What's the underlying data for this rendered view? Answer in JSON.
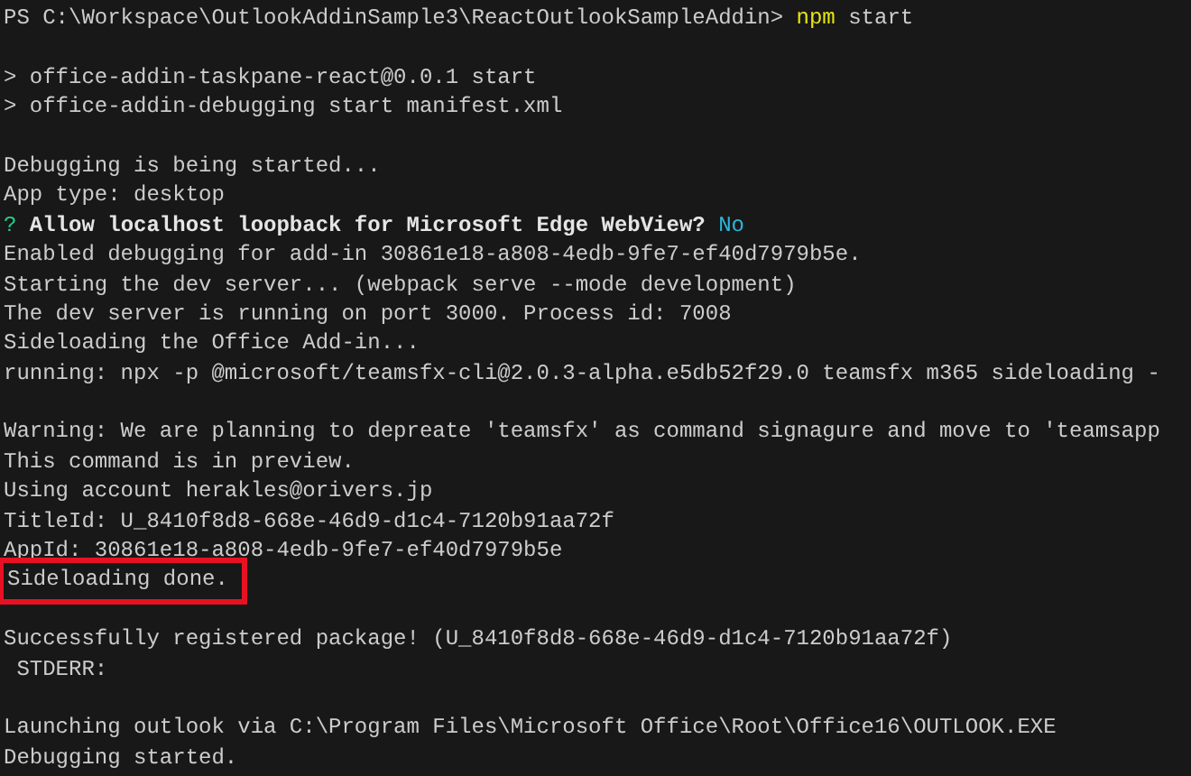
{
  "terminal": {
    "lines": [
      {
        "kind": "text",
        "segments": [
          {
            "kind": "plain",
            "text": "PS C:\\Workspace\\OutlookAddinSample3\\ReactOutlookSampleAddin> "
          },
          {
            "kind": "command",
            "text": "npm"
          },
          {
            "kind": "plain",
            "text": " start"
          }
        ]
      },
      {
        "kind": "blank"
      },
      {
        "kind": "text",
        "segments": [
          {
            "kind": "plain",
            "text": "> office-addin-taskpane-react@0.0.1 start"
          }
        ]
      },
      {
        "kind": "text",
        "segments": [
          {
            "kind": "plain",
            "text": "> office-addin-debugging start manifest.xml"
          }
        ]
      },
      {
        "kind": "blank"
      },
      {
        "kind": "text",
        "segments": [
          {
            "kind": "plain",
            "text": "Debugging is being started..."
          }
        ]
      },
      {
        "kind": "text",
        "segments": [
          {
            "kind": "plain",
            "text": "App type: desktop"
          }
        ]
      },
      {
        "kind": "text",
        "segments": [
          {
            "kind": "question",
            "text": "?"
          },
          {
            "kind": "bold",
            "text": " Allow localhost loopback for Microsoft Edge WebView?"
          },
          {
            "kind": "answer",
            "text": "No"
          }
        ]
      },
      {
        "kind": "text",
        "segments": [
          {
            "kind": "plain",
            "text": "Enabled debugging for add-in 30861e18-a808-4edb-9fe7-ef40d7979b5e."
          }
        ]
      },
      {
        "kind": "text",
        "segments": [
          {
            "kind": "plain",
            "text": "Starting the dev server... (webpack serve --mode development)"
          }
        ]
      },
      {
        "kind": "text",
        "segments": [
          {
            "kind": "plain",
            "text": "The dev server is running on port 3000. Process id: 7008"
          }
        ]
      },
      {
        "kind": "text",
        "segments": [
          {
            "kind": "plain",
            "text": "Sideloading the Office Add-in..."
          }
        ]
      },
      {
        "kind": "text",
        "segments": [
          {
            "kind": "plain",
            "text": "running: npx -p @microsoft/teamsfx-cli@2.0.3-alpha.e5db52f29.0 teamsfx m365 sideloading -"
          }
        ]
      },
      {
        "kind": "blank"
      },
      {
        "kind": "text",
        "segments": [
          {
            "kind": "plain",
            "text": "Warning: We are planning to depreate 'teamsfx' as command signagure and move to 'teamsapp"
          }
        ]
      },
      {
        "kind": "text",
        "segments": [
          {
            "kind": "plain",
            "text": "This command is in preview."
          }
        ]
      },
      {
        "kind": "text",
        "segments": [
          {
            "kind": "plain",
            "text": "Using account herakles@orivers.jp"
          }
        ]
      },
      {
        "kind": "text",
        "segments": [
          {
            "kind": "plain",
            "text": "TitleId: U_8410f8d8-668e-46d9-d1c4-7120b91aa72f"
          }
        ]
      },
      {
        "kind": "text",
        "segments": [
          {
            "kind": "plain",
            "text": "AppId: 30861e18-a808-4edb-9fe7-ef40d7979b5e"
          }
        ]
      },
      {
        "kind": "text",
        "highlighted": true,
        "segments": [
          {
            "kind": "plain",
            "text": "Sideloading done."
          }
        ]
      },
      {
        "kind": "blank"
      },
      {
        "kind": "text",
        "segments": [
          {
            "kind": "plain",
            "text": "Successfully registered package! (U_8410f8d8-668e-46d9-d1c4-7120b91aa72f)"
          }
        ]
      },
      {
        "kind": "text",
        "segments": [
          {
            "kind": "plain",
            "text": " STDERR:"
          }
        ]
      },
      {
        "kind": "blank"
      },
      {
        "kind": "text",
        "segments": [
          {
            "kind": "plain",
            "text": "Launching outlook via C:\\Program Files\\Microsoft Office\\Root\\Office16\\OUTLOOK.EXE"
          }
        ]
      },
      {
        "kind": "text",
        "segments": [
          {
            "kind": "plain",
            "text": "Debugging started."
          }
        ]
      }
    ]
  }
}
